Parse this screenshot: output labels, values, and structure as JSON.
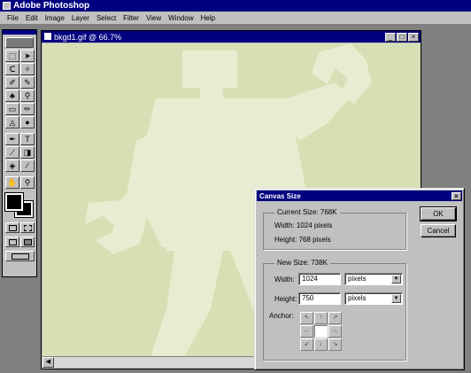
{
  "app": {
    "title": "Adobe Photoshop"
  },
  "menu": [
    "File",
    "Edit",
    "Image",
    "Layer",
    "Select",
    "Filter",
    "View",
    "Window",
    "Help"
  ],
  "toolbox": {
    "tools": [
      {
        "icon": "⬚",
        "name": "marquee-tool-icon"
      },
      {
        "icon": "➤",
        "name": "move-tool-icon"
      },
      {
        "icon": "ᑕ",
        "name": "lasso-tool-icon"
      },
      {
        "icon": "✧",
        "name": "magic-wand-tool-icon"
      },
      {
        "icon": "✐",
        "name": "airbrush-tool-icon"
      },
      {
        "icon": "✎",
        "name": "paintbrush-tool-icon"
      },
      {
        "icon": "♣",
        "name": "rubber-stamp-tool-icon"
      },
      {
        "icon": "⚲",
        "name": "history-brush-tool-icon"
      },
      {
        "icon": "▭",
        "name": "eraser-tool-icon"
      },
      {
        "icon": "✏",
        "name": "pencil-tool-icon"
      },
      {
        "icon": "◬",
        "name": "blur-tool-icon"
      },
      {
        "icon": "●",
        "name": "dodge-tool-icon"
      },
      {
        "icon": "✒",
        "name": "pen-tool-icon",
        "gap": true
      },
      {
        "icon": "T",
        "name": "type-tool-icon",
        "gap": true
      },
      {
        "icon": "⟋",
        "name": "measure-tool-icon"
      },
      {
        "icon": "◨",
        "name": "gradient-tool-icon"
      },
      {
        "icon": "◈",
        "name": "paint-bucket-tool-icon"
      },
      {
        "icon": "⁄",
        "name": "eyedropper-tool-icon"
      },
      {
        "icon": "✋",
        "name": "hand-tool-icon",
        "gap": true
      },
      {
        "icon": "⚲",
        "name": "zoom-tool-icon",
        "gap": true
      }
    ]
  },
  "document": {
    "title": "bkgd1.gif @ 66.7%",
    "canvas_color": "#d6e0b4",
    "figure_color": "#e8edd1"
  },
  "dialog": {
    "title": "Canvas Size",
    "current_size": {
      "legend": "Current Size: 768K",
      "width_text": "Width: 1024 pixels",
      "height_text": "Height: 768 pixels"
    },
    "new_size": {
      "legend": "New Size: 738K",
      "width_label": "Width:",
      "width_value": "1024",
      "width_unit": "pixels",
      "height_label": "Height:",
      "height_value": "750",
      "height_unit": "pixels",
      "anchor_label": "Anchor:"
    },
    "anchor_arrows": [
      "↖",
      "↑",
      "↗",
      "←",
      "",
      "→",
      "↙",
      "↓",
      "↘"
    ],
    "ok_label": "OK",
    "cancel_label": "Cancel"
  },
  "colors": {
    "titlebar": "#000080",
    "chrome": "#c0c0c0",
    "workspace": "#808080"
  }
}
